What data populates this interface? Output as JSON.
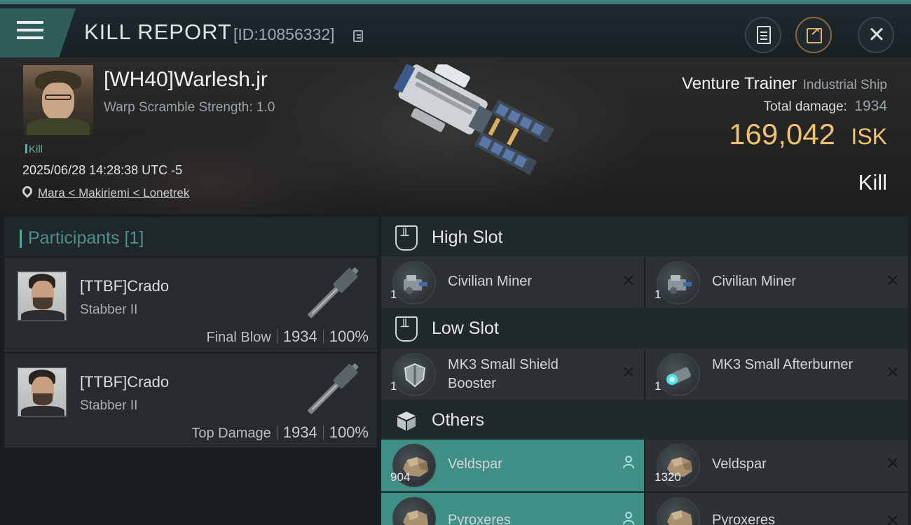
{
  "topbar": {
    "title": "KILL REPORT",
    "report_id": "[ID:10856332]",
    "icons": [
      "menu-icon",
      "copy-icon",
      "document-icon",
      "share-icon",
      "close-icon"
    ]
  },
  "victim": {
    "name": "[WH40]Warlesh.jr",
    "warp_scramble": "Warp Scramble Strength: 1.0",
    "tag": "Kill",
    "time": "2025/06/28 14:28:38 UTC -5",
    "location": "Mara < Makiriemi < Lonetrek",
    "ship_name": "Venture Trainer",
    "ship_class": "Industrial Ship",
    "total_damage_label": "Total damage:",
    "total_damage": "1934",
    "isk_value": "169,042",
    "isk_unit": "ISK",
    "kill_type": "Kill"
  },
  "participants": {
    "title": "Participants [1]",
    "rows": [
      {
        "name": "[TTBF]Crado",
        "ship": "Stabber II",
        "role": "Final Blow",
        "damage": "1934",
        "percent": "100%"
      },
      {
        "name": "[TTBF]Crado",
        "ship": "Stabber II",
        "role": "Top Damage",
        "damage": "1934",
        "percent": "100%"
      }
    ]
  },
  "fitting": {
    "high_slot": {
      "title": "High Slot",
      "items": [
        {
          "name": "Civilian Miner",
          "qty": "1",
          "action": "✕"
        },
        {
          "name": "Civilian Miner",
          "qty": "1",
          "action": "✕"
        }
      ]
    },
    "low_slot": {
      "title": "Low Slot",
      "items": [
        {
          "name": "MK3 Small Shield Booster",
          "qty": "1",
          "action": "✕"
        },
        {
          "name": "MK3 Small Afterburner",
          "qty": "1",
          "action": "✕"
        }
      ]
    },
    "others": {
      "title": "Others",
      "items": [
        {
          "name": "Veldspar",
          "qty": "904",
          "action": "person-icon",
          "selected": true
        },
        {
          "name": "Veldspar",
          "qty": "1320",
          "action": "✕"
        },
        {
          "name": "Pyroxeres",
          "qty": "",
          "action": "person-icon",
          "selected": true
        },
        {
          "name": "Pyroxeres",
          "qty": "",
          "action": "✕"
        }
      ]
    }
  },
  "colors": {
    "accent": "#3f8f86",
    "isk": "#f0c26b",
    "panel": "#2b3134"
  }
}
